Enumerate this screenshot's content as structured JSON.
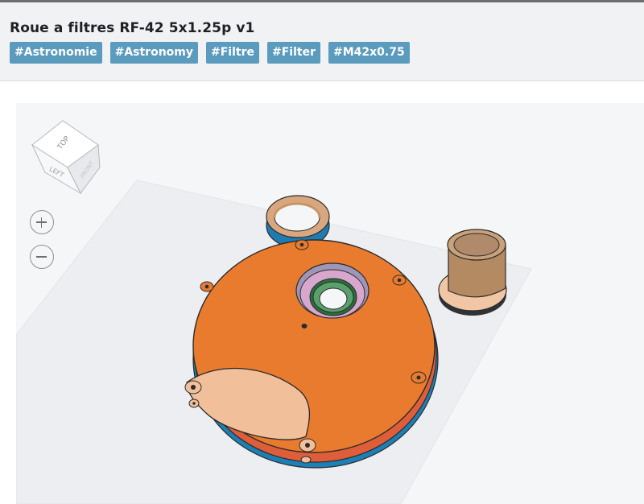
{
  "page": {
    "title": "Roue a filtres RF-42 5x1.25p v1",
    "tags": [
      "#Astronomie",
      "#Astronomy",
      "#Filtre",
      "#Filter",
      "#M42x0.75"
    ]
  },
  "viewer": {
    "viewcube": {
      "top_label": "TOP",
      "left_label": "LEFT",
      "front_label": "FRONT"
    },
    "zoom_in_icon": "plus-icon",
    "zoom_out_icon": "minus-icon"
  },
  "colors": {
    "header_bg": "#f1f2f4",
    "tag_bg": "#5b9bbd",
    "viewer_bg": "#f5f6f7",
    "wheel_orange": "#e87b2e",
    "cover_peach": "#f2bf9b",
    "adapter_tan": "#c9a27a"
  }
}
